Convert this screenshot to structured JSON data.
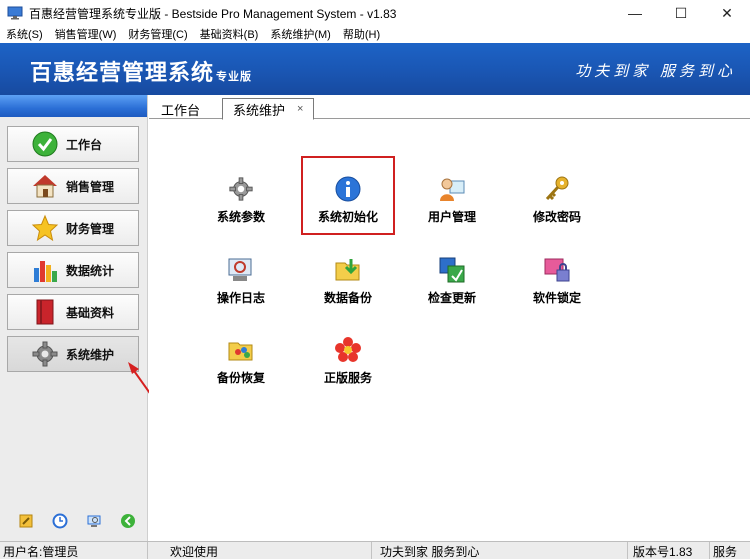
{
  "window": {
    "title": "百惠经营管理系统专业版 - Bestside Pro Management System - v1.83",
    "icon": "monitor-app-icon",
    "controls": [
      "minimize",
      "maximize",
      "close"
    ]
  },
  "menubar": {
    "items": [
      "系统(S)",
      "销售管理(W)",
      "财务管理(C)",
      "基础资料(B)",
      "系统维护(M)",
      "帮助(H)"
    ]
  },
  "banner": {
    "brand": "百惠经营管理系统",
    "brand_sub": "专业版",
    "slogan": "功夫到家 服务到心",
    "color": "#1a56b3"
  },
  "sidebar": {
    "items": [
      {
        "label": "工作台",
        "icon": "check-circle-icon"
      },
      {
        "label": "销售管理",
        "icon": "house-icon"
      },
      {
        "label": "财务管理",
        "icon": "star-icon"
      },
      {
        "label": "数据统计",
        "icon": "bar-chart-icon"
      },
      {
        "label": "基础资料",
        "icon": "book-icon"
      },
      {
        "label": "系统维护",
        "icon": "gear-icon",
        "active": true
      }
    ],
    "tools": [
      "key-icon",
      "clock-icon",
      "monitor-icon",
      "refresh-icon"
    ]
  },
  "tabs": [
    {
      "label": "工作台",
      "active": false
    },
    {
      "label": "系统维护",
      "active": true,
      "close": "×"
    }
  ],
  "tiles": [
    {
      "label": "系统参数",
      "icon": "gear-icon"
    },
    {
      "label": "系统初始化",
      "icon": "info-icon",
      "highlighted": true
    },
    {
      "label": "用户管理",
      "icon": "users-icon"
    },
    {
      "label": "修改密码",
      "icon": "key-icon"
    },
    {
      "label": "操作日志",
      "icon": "log-icon"
    },
    {
      "label": "数据备份",
      "icon": "folder-download-icon"
    },
    {
      "label": "检查更新",
      "icon": "update-icon"
    },
    {
      "label": "软件锁定",
      "icon": "lock-icon"
    },
    {
      "label": "备份恢复",
      "icon": "folder-restore-icon"
    },
    {
      "label": "正版服务",
      "icon": "flower-icon"
    }
  ],
  "statusbar": {
    "user": "用户名:管理员",
    "welcome": "欢迎使用",
    "slogan": "功夫到家 服务到心",
    "version": "版本号1.83",
    "service": "服务"
  },
  "colors": {
    "accent": "#1a56b3",
    "highlight": "#d02020"
  }
}
